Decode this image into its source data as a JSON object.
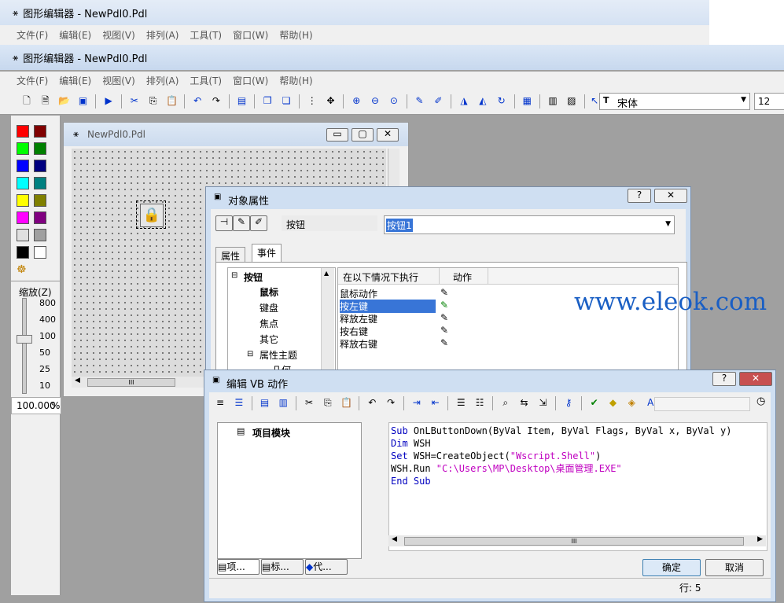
{
  "back_window": {
    "title": "图形编辑器 - NewPdl0.Pdl"
  },
  "main_window": {
    "title": "图形编辑器 - NewPdl0.Pdl"
  },
  "menu": [
    "文件(F)",
    "编辑(E)",
    "视图(V)",
    "排列(A)",
    "工具(T)",
    "窗口(W)",
    "帮助(H)"
  ],
  "toolbar": {
    "font_name": "宋体",
    "font_size": "12"
  },
  "palette": {
    "colors": [
      "#ff0000",
      "#800000",
      "#00ff00",
      "#008000",
      "#0000ff",
      "#000080",
      "#00ffff",
      "#008080",
      "#ffff00",
      "#808000",
      "#ff00ff",
      "#800080",
      "#e0e0e0",
      "#a0a0a0",
      "#000000",
      "#ffffff"
    ]
  },
  "zoom": {
    "label": "缩放(Z)",
    "ticks": [
      "800",
      "400",
      "100",
      "50",
      "25",
      "10"
    ],
    "value": "100.000",
    "unit": "%"
  },
  "doc_window": {
    "title": "NewPdl0.Pdl",
    "hscroll_label": "III"
  },
  "props_dialog": {
    "title": "对象属性",
    "help": "?",
    "type_label": "按钮",
    "name_value": "按钮1",
    "tabs": [
      "属性",
      "事件"
    ],
    "tree": {
      "root": "按钮",
      "items": [
        "鼠标",
        "键盘",
        "焦点",
        "其它"
      ],
      "group": "属性主题",
      "sub": "几何"
    },
    "list_headers": [
      "在以下情况下执行",
      "动作"
    ],
    "events": [
      "鼠标动作",
      "按左键",
      "释放左键",
      "按右键",
      "释放右键"
    ]
  },
  "vb_dialog": {
    "title": "编辑 VB 动作",
    "help": "?",
    "tree_root": "项目模块",
    "bottom_tabs": [
      "项...",
      "标...",
      "代..."
    ],
    "code": [
      {
        "kw": "Sub",
        "rest": " OnLButtonDown(ByVal Item, ByVal Flags, ByVal x, ByVal y)"
      },
      {
        "kw": "Dim",
        "rest": " WSH"
      },
      {
        "kw": "Set",
        "rest": " WSH=CreateObject(",
        "str": "\"Wscript.Shell\"",
        "tail": ")"
      },
      {
        "kw": "",
        "rest": "WSH.Run ",
        "str": "\"C:\\Users\\MP\\Desktop\\桌面管理.EXE\"",
        "tail": ""
      },
      {
        "kw": "End Sub",
        "rest": ""
      }
    ],
    "ok": "确定",
    "cancel": "取消",
    "status": "行: 5",
    "hscroll_label": "III"
  },
  "watermark": "www.eleok.com"
}
